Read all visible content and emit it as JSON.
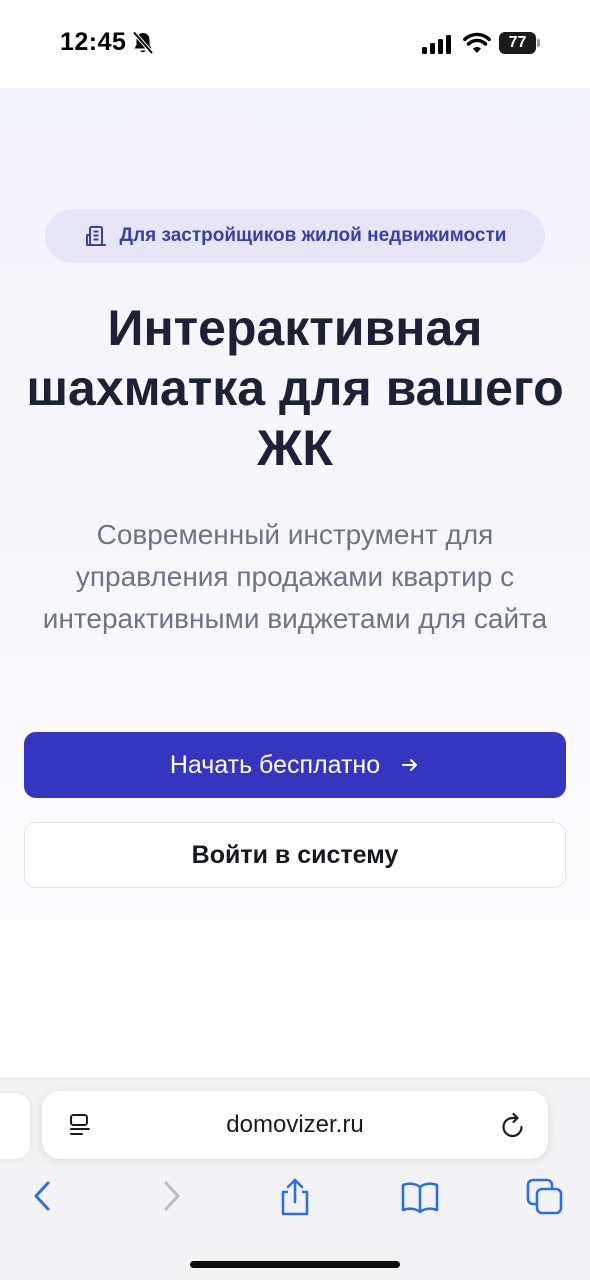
{
  "status_bar": {
    "time": "12:45",
    "battery": "77",
    "icons": [
      "bell-off-icon",
      "cellular-signal-icon",
      "wifi-icon",
      "battery-icon"
    ]
  },
  "hero": {
    "badge_icon": "building-icon",
    "badge_text": "Для застройщиков жилой недвижимости",
    "headline_lines": [
      "Интерактивная",
      "шахматка для вашего",
      "ЖК"
    ],
    "subtitle": "Современный инструмент для управления продажами квартир с интерактивными виджетами для сайта",
    "primary_button": "Начать бесплатно",
    "primary_button_icon": "arrow-right-icon",
    "secondary_button": "Войти в систему"
  },
  "browser": {
    "address": "domovizer.ru",
    "toolbar_icons": [
      "back-icon",
      "forward-icon",
      "share-icon",
      "bookmarks-icon",
      "tabs-icon"
    ]
  },
  "colors": {
    "accent": "#3535c0",
    "badge_bg": "#e6e6f7",
    "badge_text": "#3b3ea6",
    "headline": "#1d2133",
    "subtitle": "#6e7481"
  }
}
